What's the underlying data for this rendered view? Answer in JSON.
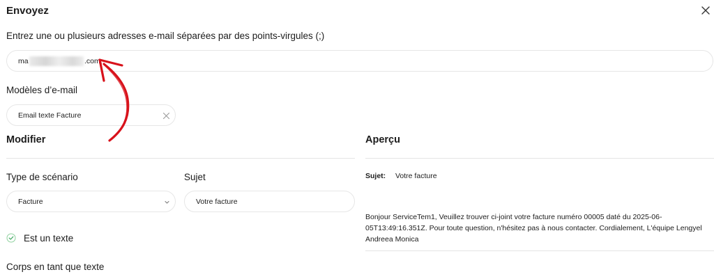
{
  "dialog": {
    "title": "Envoyez",
    "close_icon": "close-icon"
  },
  "recipients": {
    "label": "Entrez une ou plusieurs adresses e-mail séparées par des points-virgules (;)",
    "value_prefix": "ma",
    "value_suffix": ".com;"
  },
  "templates": {
    "label": "Modèles d’e-mail",
    "selected": "Email texte Facture",
    "clear_icon": "close-icon"
  },
  "edit": {
    "section_title": "Modifier",
    "scenario_label": "Type de scénario",
    "scenario_value": "Facture",
    "scenario_icon": "chevron-down-icon",
    "subject_label": "Sujet",
    "subject_value": "Votre facture",
    "is_text_label": "Est un texte",
    "is_text_icon": "check-circle-icon",
    "body_label": "Corps en tant que texte"
  },
  "preview": {
    "section_title": "Aperçu",
    "subject_label": "Sujet:",
    "subject_value": "Votre facture",
    "body": "Bonjour ServiceTem1, Veuillez trouver ci-joint votre facture numéro 00005 daté du 2025-06-05T13:49:16.351Z. Pour toute question, n'hésitez pas à nous contacter. Cordialement, L'équipe Lengyel Andreea Monica"
  },
  "colors": {
    "annotation_arrow": "#d8121b",
    "check": "#3aa55c"
  }
}
